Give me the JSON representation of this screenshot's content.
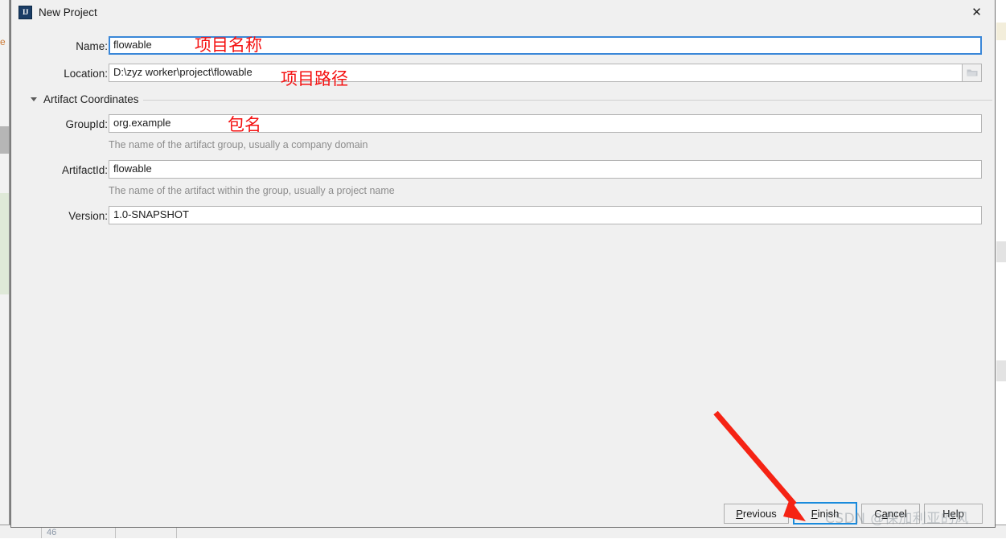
{
  "window": {
    "title": "New Project",
    "icon": "intellij-idea-icon",
    "icon_text": "IJ",
    "close_label": "✕"
  },
  "form": {
    "name": {
      "label": "Name:",
      "value": "flowable",
      "placeholder": "",
      "focused": true
    },
    "location": {
      "label": "Location:",
      "value": "D:\\zyz worker\\project\\flowable",
      "placeholder": "",
      "browse_icon": "folder-icon"
    },
    "section": {
      "label": "Artifact Coordinates",
      "expanded": true,
      "toggle_icon": "chevron-down-icon"
    },
    "group_id": {
      "label": "GroupId:",
      "value": "org.example",
      "hint": "The name of the artifact group, usually a company domain"
    },
    "artifact_id": {
      "label": "ArtifactId:",
      "value": "flowable",
      "hint": "The name of the artifact within the group, usually a project name"
    },
    "version": {
      "label": "Version:",
      "value": "1.0-SNAPSHOT",
      "hint": ""
    }
  },
  "annotations": [
    {
      "text": "项目名称",
      "note": "project name"
    },
    {
      "text": "项目路径",
      "note": "project path"
    },
    {
      "text": "包名",
      "note": "package name"
    }
  ],
  "buttons": {
    "previous": {
      "mnemonic": "P",
      "rest": "revious"
    },
    "finish": {
      "mnemonic": "F",
      "rest": "inish",
      "is_default": true
    },
    "cancel": {
      "pre": "C",
      "mnemonic": "a",
      "rest": "ncel"
    },
    "help": {
      "pre": "H",
      "mnemonic": "e",
      "rest": "lp"
    }
  },
  "watermark": {
    "text": "CSDN @保加利亚的风"
  },
  "background": {
    "left_fragment_text": "e",
    "status_number": "46"
  },
  "colors": {
    "accent_blue": "#1a8bdc",
    "focus_blue": "#3a87d8",
    "annotation_red": "#f41111",
    "dialog_bg": "#f0f0f0",
    "field_bg": "#ffffff",
    "hint_grey": "#8c8c8c"
  }
}
